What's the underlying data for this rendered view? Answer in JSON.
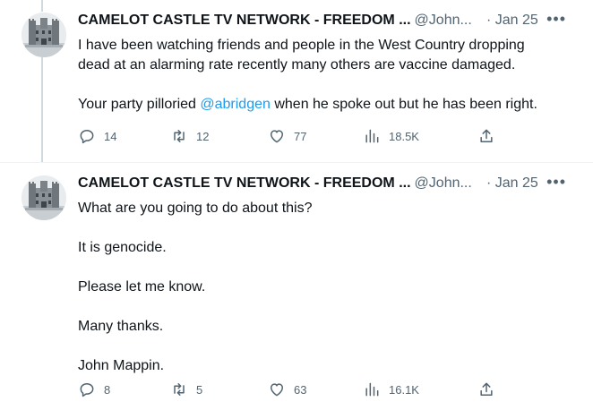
{
  "tweets": [
    {
      "author_name": "CAMELOT CASTLE TV NETWORK - FREEDOM ...",
      "handle": "@John...",
      "date": "· Jan 25",
      "more_icon": "more-icon",
      "text_line1": "I have been watching friends and people in the West Country dropping",
      "text_line2": "dead at an alarming rate recently many others are vaccine damaged.",
      "text_p2_before": "Your party pilloried ",
      "mention": "@abridgen",
      "text_p2_after": " when he spoke out but he has been right.",
      "replies": "14",
      "retweets": "12",
      "likes": "77",
      "views": "18.5K"
    },
    {
      "author_name": "CAMELOT CASTLE TV NETWORK - FREEDOM ...",
      "handle": "@John...",
      "date": "· Jan 25",
      "paragraphs": [
        "What are you going to do about this?",
        "It is genocide.",
        "Please let me know.",
        "Many thanks.",
        "John Mappin."
      ],
      "replies": "8",
      "retweets": "5",
      "likes": "63",
      "views": "16.1K"
    }
  ],
  "colors": {
    "text": "#0f1419",
    "secondary": "#536471",
    "link": "#1d9bf0",
    "thread_line": "#cfd9de",
    "divider": "#eff3f4"
  }
}
